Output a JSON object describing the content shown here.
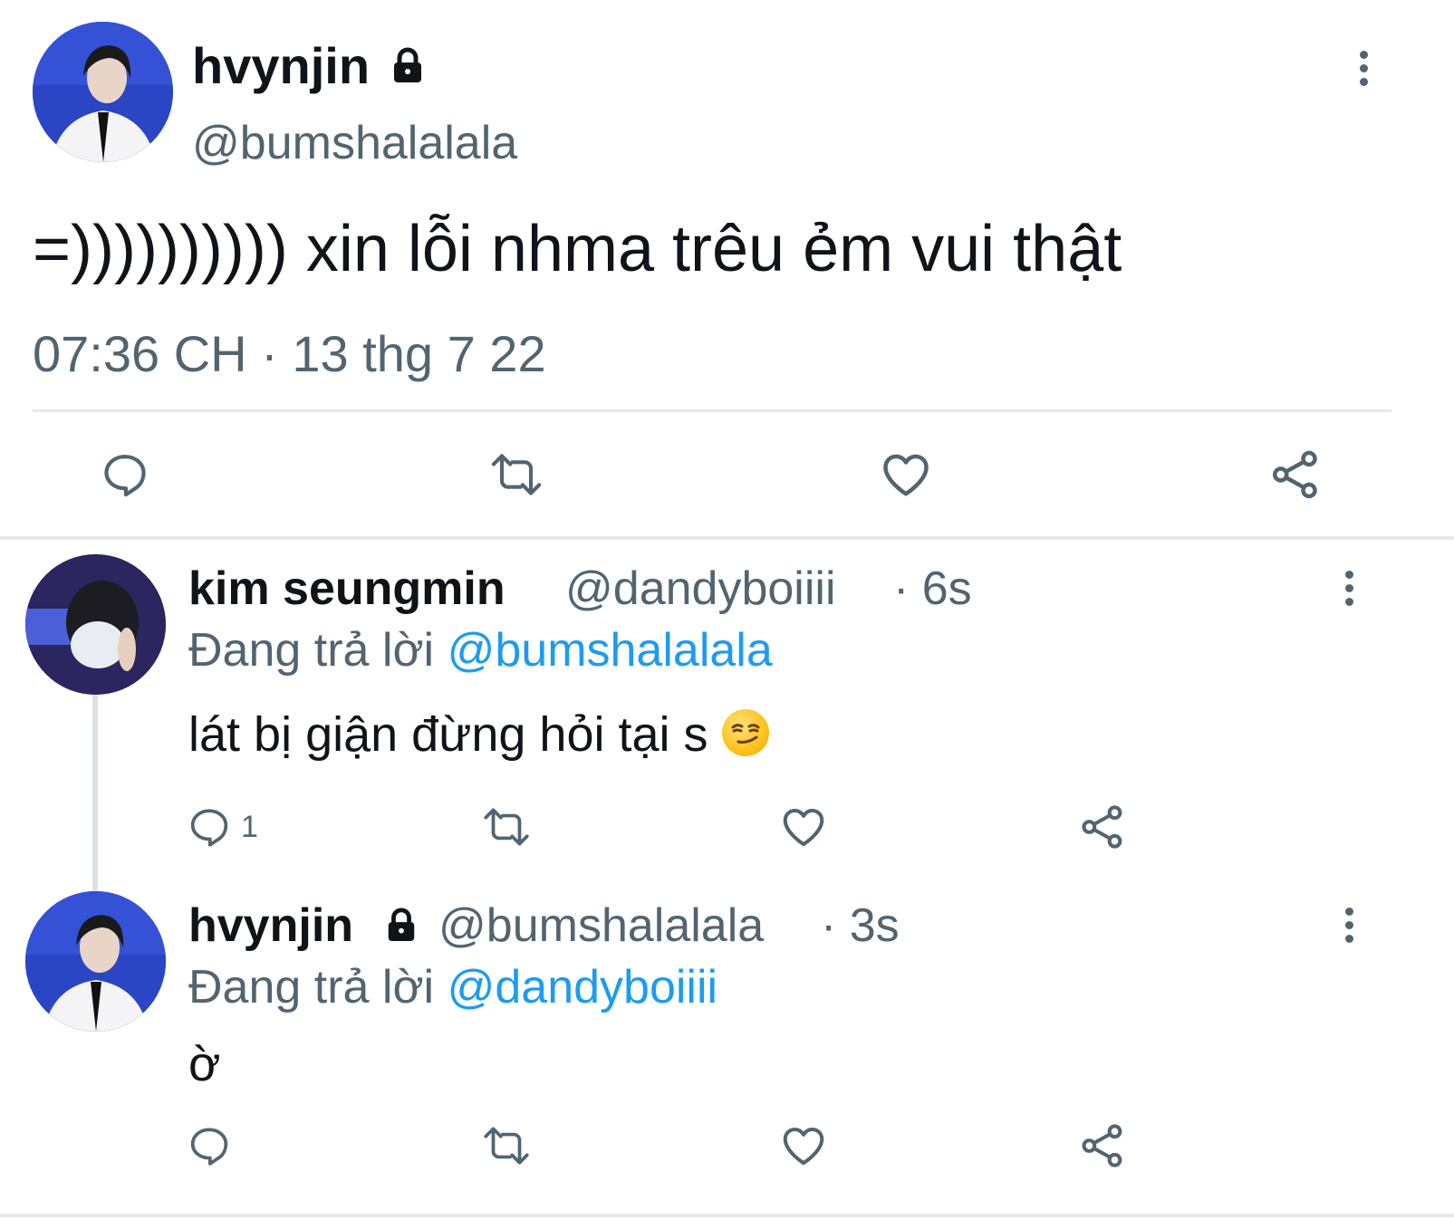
{
  "main_tweet": {
    "display_name": "hvynjin",
    "handle": "@bumshalalala",
    "text": "=)))))))))) xin lỗi nhma trêu ẻm vui thật",
    "timestamp": "07:36 CH · 13 thg 7 22",
    "protected": true
  },
  "replies": [
    {
      "display_name": "kim seungmin",
      "handle": "@dandyboiiii",
      "time": "· 6s",
      "replying_label": "Đang trả lời",
      "replying_to": "@bumshalalala",
      "text": "lát bị giận đừng hỏi tại s",
      "emoji": "smirking-face",
      "reply_count": "1"
    },
    {
      "display_name": "hvynjin",
      "handle": "@bumshalalala",
      "time": "· 3s",
      "replying_label": "Đang trả lời",
      "replying_to": "@dandyboiiii",
      "text": "ờ",
      "protected": true
    }
  ],
  "colors": {
    "text": "#0f1419",
    "muted": "#536471",
    "link": "#1d9bf0",
    "divider": "#e6e9ec"
  },
  "icons": [
    "comment-icon",
    "retweet-icon",
    "like-icon",
    "share-icon",
    "more-icon",
    "lock-icon"
  ]
}
